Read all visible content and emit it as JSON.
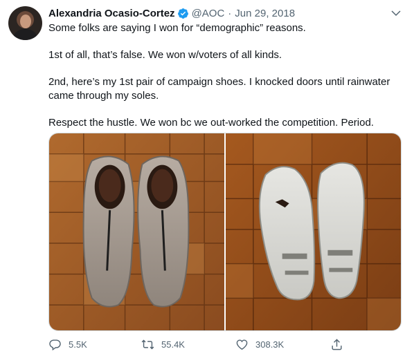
{
  "tweet": {
    "author_name": "Alexandria Ocasio-Cortez",
    "handle": "@AOC",
    "separator": "·",
    "date": "Jun 29, 2018",
    "paragraphs": [
      "Some folks are saying I won for “demographic” reasons.",
      "1st of all, that’s false. We won w/voters of all kinds.",
      "2nd, here’s my 1st pair of campaign shoes. I knocked doors until rainwater came through my soles.",
      "Respect the hustle. We won bc we out-worked the competition. Period."
    ],
    "media": [
      {
        "icon": "shoes-top-photo"
      },
      {
        "icon": "shoes-soles-photo"
      }
    ],
    "metrics": {
      "replies": "5.5K",
      "retweets": "55.4K",
      "likes": "308.3K"
    },
    "verified_color": "#1d9bf0",
    "icons": {
      "verified": "verified-badge-icon",
      "more": "chevron-down-icon",
      "reply": "reply-icon",
      "retweet": "retweet-icon",
      "like": "heart-icon",
      "share": "share-icon"
    }
  }
}
